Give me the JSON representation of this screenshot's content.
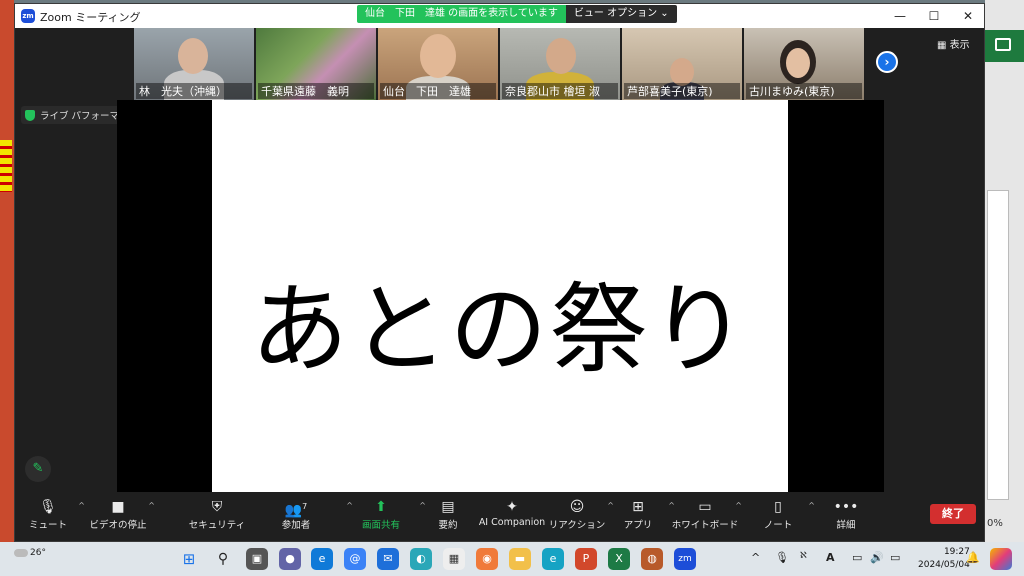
{
  "window": {
    "app_title": "Zoom ミーティング",
    "logo_text": "zm",
    "share_banner": "仙台　下田　達雄 の画面を表示しています",
    "view_options": "ビュー オプション",
    "minimize": "—",
    "maximize": "☐",
    "close": "✕"
  },
  "participants": [
    {
      "name": "林　光夫（沖縄）"
    },
    {
      "name": "千葉県遠藤　義明"
    },
    {
      "name": "仙台　下田　達雄"
    },
    {
      "name": "奈良郡山市 檜垣 淑"
    },
    {
      "name": "芦部喜美子(東京)"
    },
    {
      "name": "古川まゆみ(東京)"
    }
  ],
  "view_button": "表示",
  "audio_badge": "ライブ パフォーマンス オーディオ: オフ",
  "slide_text": "あとの祭り",
  "toolbar": {
    "mute": "ミュート",
    "video": "ビデオの停止",
    "security": "セキュリティ",
    "participants": "参加者",
    "participants_count": "7",
    "share": "画面共有",
    "summary": "要約",
    "ai": "AI Companion",
    "reactions": "リアクション",
    "apps": "アプリ",
    "whiteboard": "ホワイトボード",
    "notes": "ノート",
    "more": "詳細",
    "end": "終了"
  },
  "taskbar": {
    "weather": "26°",
    "time": "19:27",
    "date": "2024/05/04",
    "ime": "A"
  },
  "background": {
    "zoom_pct": "0%"
  },
  "colors": {
    "accent_green": "#23c25b",
    "end_red": "#d32f2f",
    "next_blue": "#1a73e8"
  }
}
